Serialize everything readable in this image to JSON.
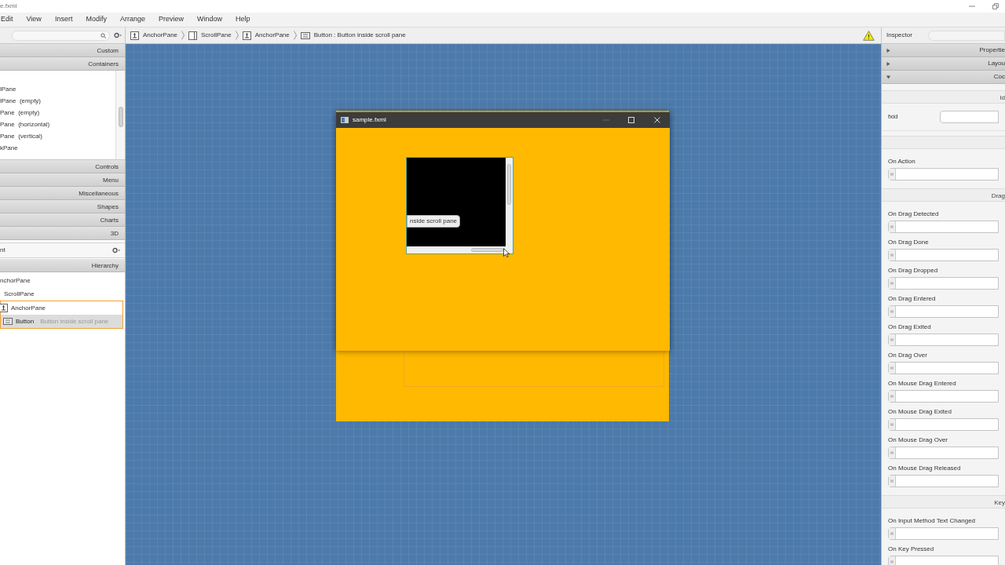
{
  "window": {
    "title": "e.fxml"
  },
  "menu": [
    "Edit",
    "View",
    "Insert",
    "Modify",
    "Arrange",
    "Preview",
    "Window",
    "Help"
  ],
  "breadcrumbs": [
    {
      "kind": "anchor",
      "label": "AnchorPane"
    },
    {
      "kind": "scroll",
      "label": "ScrollPane"
    },
    {
      "kind": "anchor",
      "label": "AnchorPane"
    },
    {
      "kind": "button",
      "label": "Button : Button inside scroll pane"
    }
  ],
  "library": {
    "sections": [
      {
        "label": "Custom"
      },
      {
        "label": "Containers",
        "items": [
          "lPane",
          "lPane  (empty)",
          "Pane  (empty)",
          "Pane  (horizontal)",
          "Pane  (vertical)",
          "kPane"
        ]
      },
      {
        "label": "Controls"
      },
      {
        "label": "Menu"
      },
      {
        "label": "Miscellaneous"
      },
      {
        "label": "Shapes"
      },
      {
        "label": "Charts"
      },
      {
        "label": "3D"
      }
    ]
  },
  "document": {
    "label": "nt",
    "hierarchy": "Hierarchy",
    "tree": [
      {
        "label": "nchorPane",
        "selected": false,
        "children": [
          {
            "label": "ScrollPane",
            "selected": false,
            "children": [
              {
                "label": "AnchorPane",
                "kind": "anchor",
                "selected": false,
                "highlighted": true,
                "children": [
                  {
                    "label": "Button",
                    "kind": "button",
                    "detail": "Button inside scroll pane",
                    "selected": true
                  }
                ]
              }
            ]
          }
        ]
      }
    ]
  },
  "preview": {
    "title": "sample.fxml",
    "button": "nside scroll pane"
  },
  "inspector": {
    "title": "Inspector",
    "sections": [
      {
        "label": "Propertie",
        "expanded": false
      },
      {
        "label": "Layou",
        "expanded": false
      },
      {
        "label": "Coc",
        "expanded": true
      }
    ],
    "groups": [
      {
        "header": "Id",
        "fields": [
          {
            "kind": "plain",
            "label": "fxid"
          }
        ]
      },
      {
        "fields": [
          {
            "kind": "handler",
            "label": "On Action"
          }
        ]
      },
      {
        "header": "Drag",
        "fields": [
          {
            "kind": "handler",
            "label": "On Drag Detected"
          },
          {
            "kind": "handler",
            "label": "On Drag Done"
          },
          {
            "kind": "handler",
            "label": "On Drag Dropped"
          },
          {
            "kind": "handler",
            "label": "On Drag Entered"
          },
          {
            "kind": "handler",
            "label": "On Drag Exited"
          },
          {
            "kind": "handler",
            "label": "On Drag Over"
          },
          {
            "kind": "handler",
            "label": "On Mouse Drag Entered"
          },
          {
            "kind": "handler",
            "label": "On Mouse Drag Exited"
          },
          {
            "kind": "handler",
            "label": "On Mouse Drag Over"
          },
          {
            "kind": "handler",
            "label": "On Mouse Drag Released"
          }
        ]
      },
      {
        "header": "Key",
        "fields": [
          {
            "kind": "handler",
            "label": "On Input Method Text Changed"
          },
          {
            "kind": "handler",
            "label": "On Key Pressed"
          }
        ]
      }
    ]
  }
}
